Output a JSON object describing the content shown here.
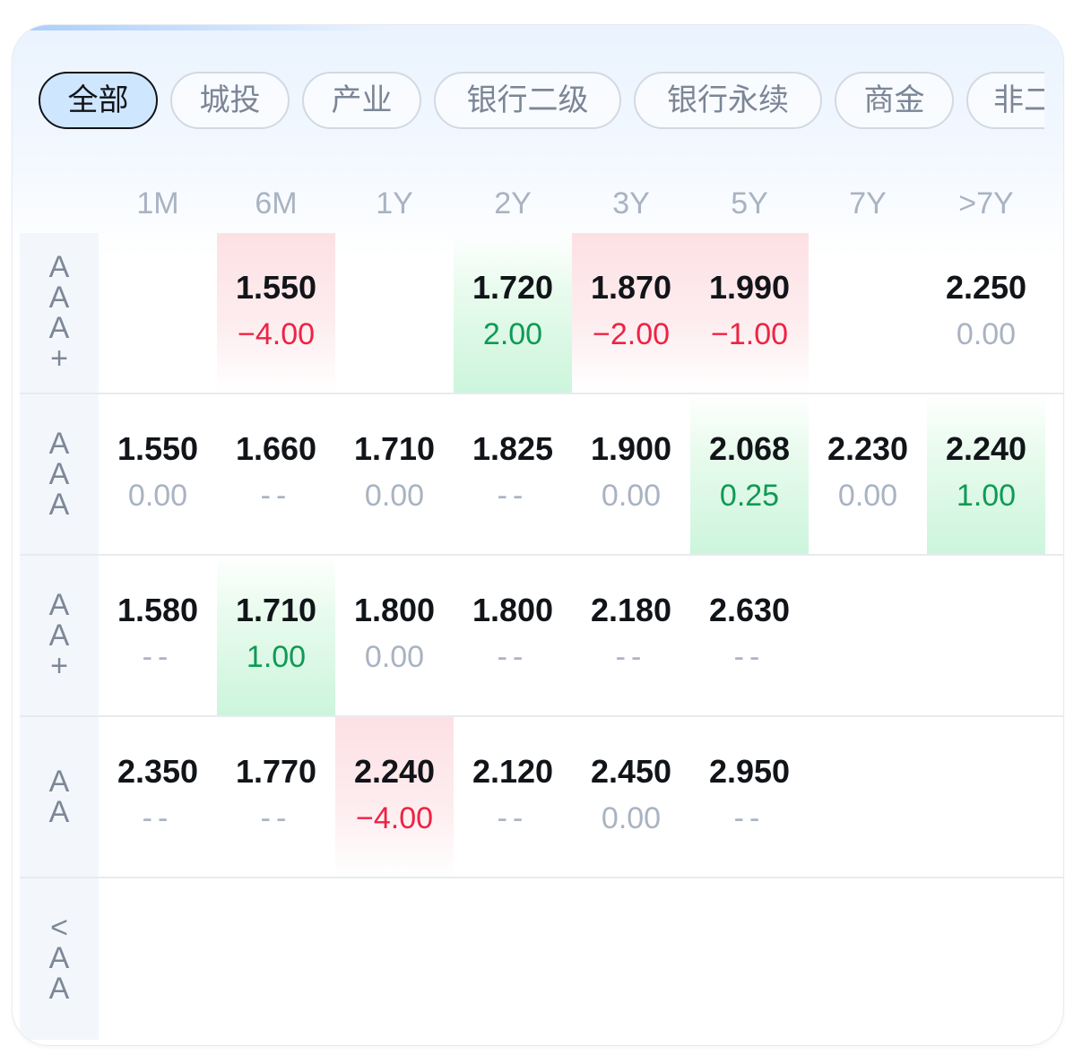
{
  "tabs": [
    {
      "label": "全部",
      "active": true
    },
    {
      "label": "城投",
      "active": false
    },
    {
      "label": "产业",
      "active": false
    },
    {
      "label": "银行二级",
      "active": false
    },
    {
      "label": "银行永续",
      "active": false
    },
    {
      "label": "商金",
      "active": false
    },
    {
      "label": "非二",
      "active": false
    }
  ],
  "columns": [
    "1M",
    "6M",
    "1Y",
    "2Y",
    "3Y",
    "5Y",
    "7Y",
    ">7Y"
  ],
  "rows": [
    {
      "label": [
        "A",
        "A",
        "A",
        "+"
      ],
      "cells": [
        null,
        {
          "value": "1.550",
          "change": "−4.00",
          "trend": "down"
        },
        null,
        {
          "value": "1.720",
          "change": "2.00",
          "trend": "up"
        },
        {
          "value": "1.870",
          "change": "−2.00",
          "trend": "down"
        },
        {
          "value": "1.990",
          "change": "−1.00",
          "trend": "down"
        },
        null,
        {
          "value": "2.250",
          "change": "0.00",
          "trend": "flat"
        }
      ]
    },
    {
      "label": [
        "A",
        "A",
        "A"
      ],
      "cells": [
        {
          "value": "1.550",
          "change": "0.00",
          "trend": "flat"
        },
        {
          "value": "1.660",
          "change": "--",
          "trend": "none"
        },
        {
          "value": "1.710",
          "change": "0.00",
          "trend": "flat"
        },
        {
          "value": "1.825",
          "change": "--",
          "trend": "none"
        },
        {
          "value": "1.900",
          "change": "0.00",
          "trend": "flat"
        },
        {
          "value": "2.068",
          "change": "0.25",
          "trend": "up"
        },
        {
          "value": "2.230",
          "change": "0.00",
          "trend": "flat"
        },
        {
          "value": "2.240",
          "change": "1.00",
          "trend": "up"
        }
      ]
    },
    {
      "label": [
        "A",
        "A",
        "+"
      ],
      "cells": [
        {
          "value": "1.580",
          "change": "--",
          "trend": "none"
        },
        {
          "value": "1.710",
          "change": "1.00",
          "trend": "up"
        },
        {
          "value": "1.800",
          "change": "0.00",
          "trend": "flat"
        },
        {
          "value": "1.800",
          "change": "--",
          "trend": "none"
        },
        {
          "value": "2.180",
          "change": "--",
          "trend": "none"
        },
        {
          "value": "2.630",
          "change": "--",
          "trend": "none"
        },
        null,
        null
      ]
    },
    {
      "label": [
        "A",
        "A"
      ],
      "cells": [
        {
          "value": "2.350",
          "change": "--",
          "trend": "none"
        },
        {
          "value": "1.770",
          "change": "--",
          "trend": "none"
        },
        {
          "value": "2.240",
          "change": "−4.00",
          "trend": "down"
        },
        {
          "value": "2.120",
          "change": "--",
          "trend": "none"
        },
        {
          "value": "2.450",
          "change": "0.00",
          "trend": "flat"
        },
        {
          "value": "2.950",
          "change": "--",
          "trend": "none"
        },
        null,
        null
      ]
    },
    {
      "label": [
        "<",
        "A",
        "A"
      ],
      "cells": [
        null,
        null,
        null,
        null,
        null,
        null,
        null,
        null
      ]
    }
  ],
  "colors": {
    "up_text": "#0f9a55",
    "down_text": "#ee2344",
    "neutral_text": "#a9b3c2",
    "active_tab_bg": "#cfe6ff"
  }
}
